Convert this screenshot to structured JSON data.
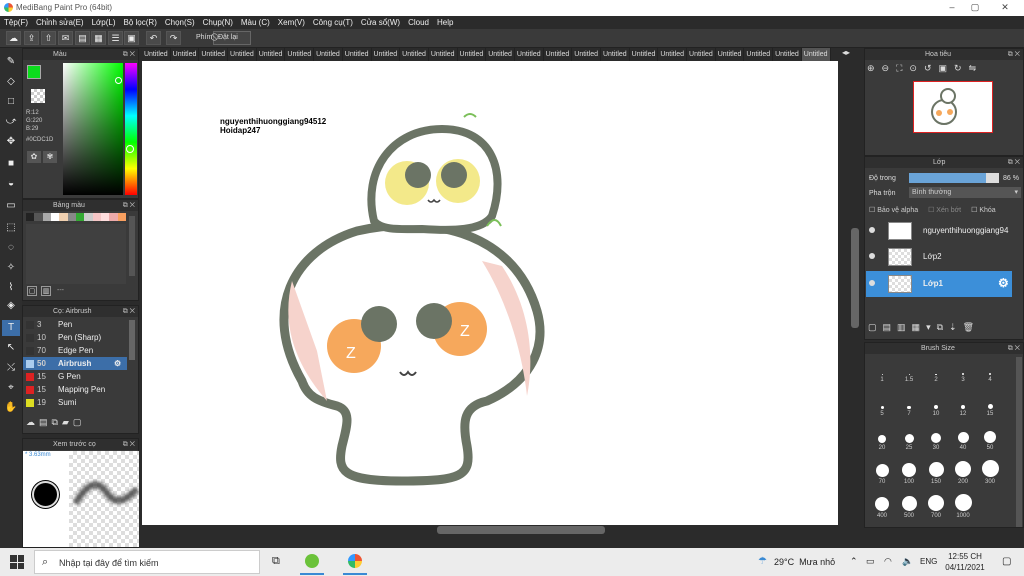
{
  "window": {
    "title": "MediBang Paint Pro (64bit)",
    "controls": [
      "–",
      "▢",
      "✕"
    ]
  },
  "menu": [
    "Tệp(F)",
    "Chỉnh sửa(E)",
    "Lớp(L)",
    "Bộ lọc(R)",
    "Chọn(S)",
    "Chụp(N)",
    "Màu (C)",
    "Xem(V)",
    "Công cụ(T)",
    "Cửa sổ(W)",
    "Cloud",
    "Help"
  ],
  "toolbar": {
    "snap_label": "Phím",
    "reset_label": "Đặt lại"
  },
  "color_panel": {
    "title": "Màu",
    "r": "R:12",
    "g": "G:220",
    "b": "B:29",
    "hex": "#0CDC1D",
    "accent": "#0CDC1D"
  },
  "palette_panel": {
    "title": "Bảng màu",
    "dash": "---"
  },
  "brush_panel": {
    "title": "Cọ: Airbrush",
    "items": [
      {
        "size": "3",
        "name": "Pen",
        "color": "#333333"
      },
      {
        "size": "10",
        "name": "Pen (Sharp)",
        "color": "#333333"
      },
      {
        "size": "70",
        "name": "Edge Pen",
        "color": "#333333"
      },
      {
        "size": "50",
        "name": "Airbrush",
        "color": "#aaccee"
      },
      {
        "size": "15",
        "name": "G Pen",
        "color": "#dd2222"
      },
      {
        "size": "15",
        "name": "Mapping Pen",
        "color": "#dd2222"
      },
      {
        "size": "19",
        "name": "Sumi",
        "color": "#dddd22"
      }
    ]
  },
  "preview_panel": {
    "title": "Xem trước cọ",
    "size": "* 3.63mm"
  },
  "doc_tabs": [
    "Untitled",
    "Untitled",
    "Untitled",
    "Untitled",
    "Untitled",
    "Untitled",
    "Untitled",
    "Untitled",
    "Untitled",
    "Untitled",
    "Untitled",
    "Untitled",
    "Untitled",
    "Untitled",
    "Untitled",
    "Untitled",
    "Untitled",
    "Untitled",
    "Untitled",
    "Untitled",
    "Untitled",
    "Untitled",
    "Untitled",
    "Untitled"
  ],
  "canvas": {
    "text_line1": "nguyenthihuonggiang94512",
    "text_line2": "Hoidap247"
  },
  "navigator": {
    "title": "Hoa tiêu"
  },
  "layer_panel": {
    "title": "Lớp",
    "opacity_label": "Độ trong",
    "opacity_value": "86 %",
    "opacity": 0.86,
    "blend_label": "Pha trộn",
    "blend_value": "Bình thường",
    "protect_alpha": "Bảo vệ alpha",
    "clip": "Xén bớt",
    "lock": "Khóa",
    "layers": [
      {
        "name": "nguyenthihuonggiang94"
      },
      {
        "name": "Lớp2"
      },
      {
        "name": "Lớp1"
      }
    ]
  },
  "brush_size_panel": {
    "title": "Brush Size",
    "sizes": [
      "1",
      "1.5",
      "2",
      "3",
      "4",
      "5",
      "7",
      "10",
      "12",
      "15",
      "20",
      "25",
      "30",
      "40",
      "50",
      "70",
      "100",
      "150",
      "200",
      "300",
      "400",
      "500",
      "700",
      "1000"
    ]
  },
  "taskbar": {
    "search_placeholder": "Nhập tại đây để tìm kiếm",
    "weather": "29°C  Mưa nhỏ",
    "lang": "ENG",
    "time": "12:55 CH",
    "date": "04/11/2021"
  }
}
